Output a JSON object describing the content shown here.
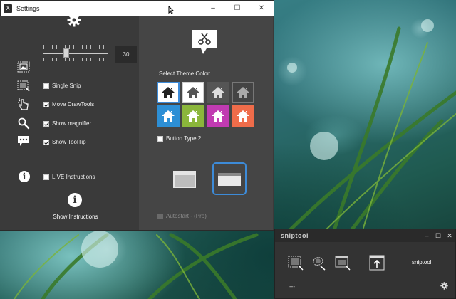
{
  "settings_window": {
    "title": "Settings",
    "app_logo": "X",
    "controls": {
      "minimize": "–",
      "maximize": "☐",
      "close": "✕"
    }
  },
  "left_pane": {
    "slider_value": "30",
    "options": [
      {
        "label": "Single Snip",
        "checked": false
      },
      {
        "label": "Move DrawTools",
        "checked": true
      },
      {
        "label": "Show magnifier",
        "checked": true
      },
      {
        "label": "Show ToolTip",
        "checked": true
      },
      {
        "label": "LIVE Instructions",
        "checked": false
      }
    ],
    "show_instructions": "Show Instructions"
  },
  "right_pane": {
    "theme_label": "Select Theme Color:",
    "themes": [
      {
        "bg": "#ffffff",
        "house": "#222222",
        "selected": false,
        "border": "#3d8bd8"
      },
      {
        "bg": "#ffffff",
        "house": "#555555",
        "selected": true,
        "border": "#cfcfcf"
      },
      {
        "bg": "#555555",
        "house": "#dddddd",
        "selected": false,
        "border": "#555555"
      },
      {
        "bg": "#444444",
        "house": "#aaaaaa",
        "selected": false,
        "border": "#777777"
      },
      {
        "bg": "#2d8fd5",
        "house": "#ffffff",
        "selected": false,
        "border": "#2d8fd5"
      },
      {
        "bg": "#8bb63b",
        "house": "#ffffff",
        "selected": false,
        "border": "#8bb63b"
      },
      {
        "bg": "#c13bb2",
        "house": "#ffffff",
        "selected": false,
        "border": "#c13bb2"
      },
      {
        "bg": "#ef6c4a",
        "house": "#ffffff",
        "selected": false,
        "border": "#ef6c4a"
      }
    ],
    "button_type_label": "Button Type 2",
    "autostart_label": "Autostart - (Pro)"
  },
  "sniptool": {
    "title": "sniptool",
    "controls": {
      "minimize": "–",
      "maximize": "☐",
      "close": "✕"
    },
    "brand": "sniptool",
    "dash": "---"
  },
  "colors": {
    "accent": "#3d8bd8",
    "pane_dark": "#3a3a3a",
    "pane_light": "#454545"
  }
}
